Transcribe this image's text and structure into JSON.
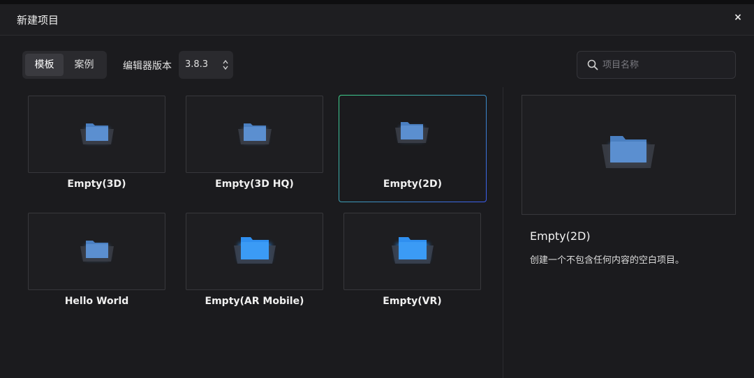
{
  "window": {
    "title": "新建项目",
    "close_label": "×"
  },
  "tabs": [
    {
      "label": "模板",
      "active": true
    },
    {
      "label": "案例",
      "active": false
    }
  ],
  "version": {
    "label": "编辑器版本",
    "value": "3.8.3"
  },
  "search": {
    "placeholder": "项目名称",
    "value": ""
  },
  "templates": [
    {
      "name": "Empty(3D)",
      "folder_color": "#4a7fc1",
      "selected": false
    },
    {
      "name": "Empty(3D HQ)",
      "folder_color": "#4a7fc1",
      "selected": false
    },
    {
      "name": "Empty(2D)",
      "folder_color": "#4a7fc1",
      "selected": true
    },
    {
      "name": "Hello World",
      "folder_color": "#4a7fc1",
      "selected": false
    },
    {
      "name": "Empty(AR Mobile)",
      "folder_color": "#2f8ff0",
      "selected": false
    },
    {
      "name": "Empty(VR)",
      "folder_color": "#2f8ff0",
      "selected": false
    }
  ],
  "preview": {
    "title": "Empty(2D)",
    "description": "创建一个不包含任何内容的空白项目。"
  },
  "colors": {
    "background": "#1b1b1e",
    "selected_gradient_start": "#3fd18a",
    "selected_gradient_end": "#3b5df0"
  }
}
